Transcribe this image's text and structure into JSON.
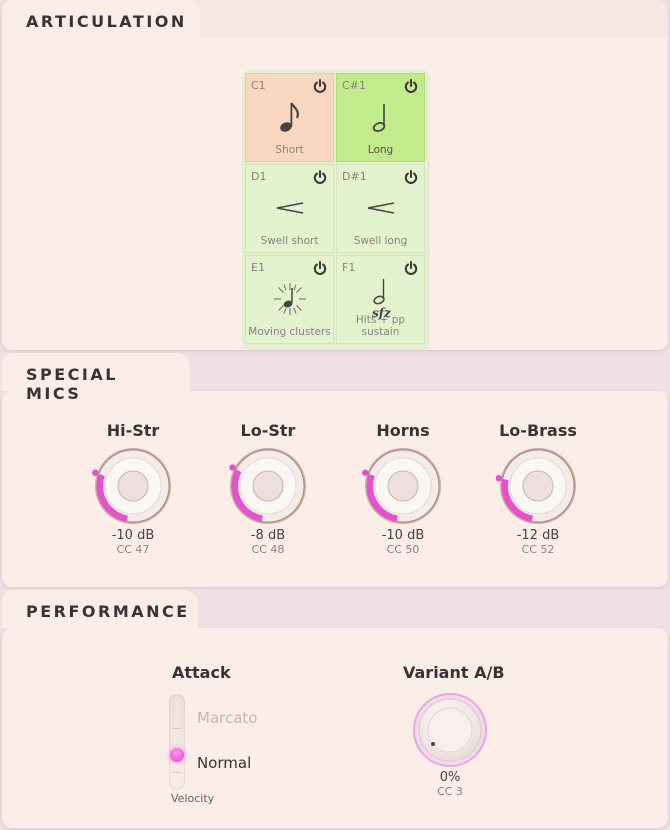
{
  "articulation": {
    "title": "ARTICULATION",
    "cells": [
      {
        "key": "C1",
        "label": "Short",
        "state": "selected-short",
        "icon": "eighth-note-icon"
      },
      {
        "key": "C#1",
        "label": "Long",
        "state": "active",
        "icon": "half-note-icon"
      },
      {
        "key": "D1",
        "label": "Swell short",
        "state": "normal",
        "icon": "crescendo-icon"
      },
      {
        "key": "D#1",
        "label": "Swell long",
        "state": "normal",
        "icon": "crescendo-icon"
      },
      {
        "key": "E1",
        "label": "Moving clusters",
        "state": "normal",
        "icon": "cluster-note-icon"
      },
      {
        "key": "F1",
        "label": "Hits + pp sustain",
        "state": "normal",
        "icon": "sfz-note-icon"
      }
    ]
  },
  "special_mics": {
    "title": "SPECIAL MICS",
    "knobs": [
      {
        "name": "Hi-Str",
        "value": "-10 dB",
        "cc": "CC 47",
        "level": 0.22
      },
      {
        "name": "Lo-Str",
        "value": "-8 dB",
        "cc": "CC 48",
        "level": 0.25
      },
      {
        "name": "Horns",
        "value": "-10 dB",
        "cc": "CC 50",
        "level": 0.22
      },
      {
        "name": "Lo-Brass",
        "value": "-12 dB",
        "cc": "CC 52",
        "level": 0.19
      }
    ]
  },
  "performance": {
    "title": "PERFORMANCE",
    "attack": {
      "title": "Attack",
      "options": [
        "Marcato",
        "Normal"
      ],
      "selected": "Normal",
      "footer": "Velocity"
    },
    "variant": {
      "title": "Variant A/B",
      "value": "0%",
      "cc": "CC 3",
      "level": 0
    }
  },
  "colors": {
    "accent": "#e84fd2",
    "short_cell": "#f9d7c1",
    "long_cell": "#c2ec8c",
    "cell": "#e2f3cd",
    "background": "#fbeee9"
  }
}
